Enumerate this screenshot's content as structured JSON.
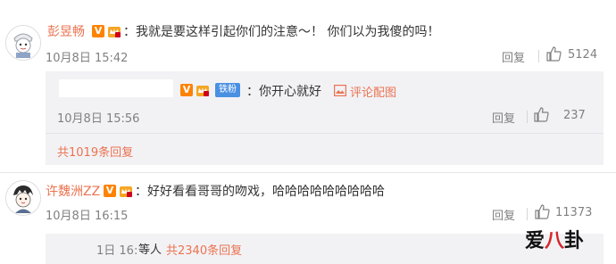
{
  "comments": [
    {
      "username": "彭昱畅",
      "text": "：我就是要这样引起你们的注意～！ 你们以为我傻的吗！",
      "time": "10月8日 15:42",
      "reply_label": "回复",
      "likes": "5124",
      "sub_reply": {
        "text": "：你开心就好",
        "fan_badge": "铁粉",
        "comment_image_label": "评论配图",
        "time": "10月8日 15:56",
        "reply_label": "回复",
        "likes": "237"
      },
      "total_replies": "共1019条回复"
    },
    {
      "username": "许魏洲ZZ",
      "text": "：好好看看哥哥的吻戏，哈哈哈哈哈哈哈哈哈",
      "time": "10月8日 16:15",
      "reply_label": "回复",
      "likes": "11373",
      "footer": {
        "prefix": "1日 16:",
        "others": "等人",
        "replies": "共2340条回复"
      }
    }
  ],
  "watermark": {
    "part1": "爱",
    "part2": "八",
    "part3": "卦"
  },
  "colors": {
    "accent": "#eb7350",
    "muted": "#808080",
    "vbadge": "#ff8200",
    "fanbadge": "#4a90e2"
  }
}
